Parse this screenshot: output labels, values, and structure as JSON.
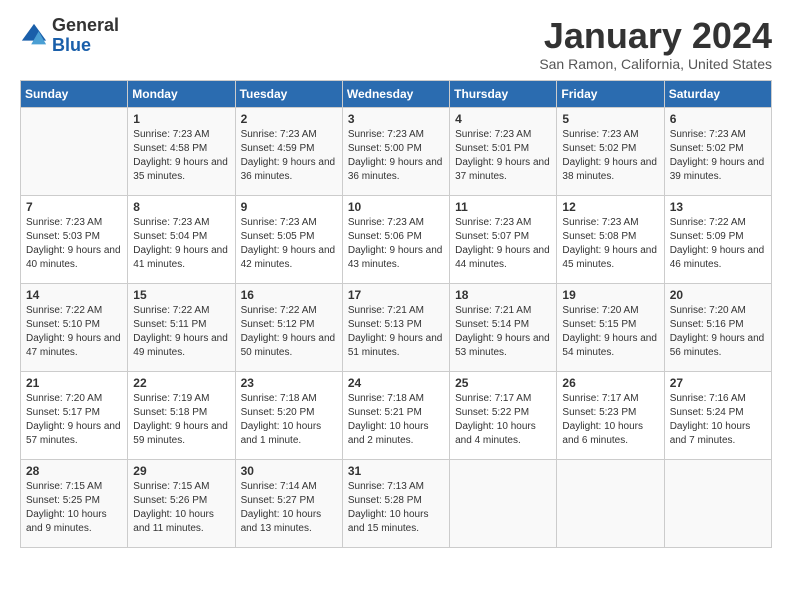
{
  "logo": {
    "general": "General",
    "blue": "Blue"
  },
  "header": {
    "title": "January 2024",
    "location": "San Ramon, California, United States"
  },
  "days_of_week": [
    "Sunday",
    "Monday",
    "Tuesday",
    "Wednesday",
    "Thursday",
    "Friday",
    "Saturday"
  ],
  "weeks": [
    [
      {
        "day": "",
        "sunrise": "",
        "sunset": "",
        "daylight": ""
      },
      {
        "day": "1",
        "sunrise": "Sunrise: 7:23 AM",
        "sunset": "Sunset: 4:58 PM",
        "daylight": "Daylight: 9 hours and 35 minutes."
      },
      {
        "day": "2",
        "sunrise": "Sunrise: 7:23 AM",
        "sunset": "Sunset: 4:59 PM",
        "daylight": "Daylight: 9 hours and 36 minutes."
      },
      {
        "day": "3",
        "sunrise": "Sunrise: 7:23 AM",
        "sunset": "Sunset: 5:00 PM",
        "daylight": "Daylight: 9 hours and 36 minutes."
      },
      {
        "day": "4",
        "sunrise": "Sunrise: 7:23 AM",
        "sunset": "Sunset: 5:01 PM",
        "daylight": "Daylight: 9 hours and 37 minutes."
      },
      {
        "day": "5",
        "sunrise": "Sunrise: 7:23 AM",
        "sunset": "Sunset: 5:02 PM",
        "daylight": "Daylight: 9 hours and 38 minutes."
      },
      {
        "day": "6",
        "sunrise": "Sunrise: 7:23 AM",
        "sunset": "Sunset: 5:02 PM",
        "daylight": "Daylight: 9 hours and 39 minutes."
      }
    ],
    [
      {
        "day": "7",
        "sunrise": "Sunrise: 7:23 AM",
        "sunset": "Sunset: 5:03 PM",
        "daylight": "Daylight: 9 hours and 40 minutes."
      },
      {
        "day": "8",
        "sunrise": "Sunrise: 7:23 AM",
        "sunset": "Sunset: 5:04 PM",
        "daylight": "Daylight: 9 hours and 41 minutes."
      },
      {
        "day": "9",
        "sunrise": "Sunrise: 7:23 AM",
        "sunset": "Sunset: 5:05 PM",
        "daylight": "Daylight: 9 hours and 42 minutes."
      },
      {
        "day": "10",
        "sunrise": "Sunrise: 7:23 AM",
        "sunset": "Sunset: 5:06 PM",
        "daylight": "Daylight: 9 hours and 43 minutes."
      },
      {
        "day": "11",
        "sunrise": "Sunrise: 7:23 AM",
        "sunset": "Sunset: 5:07 PM",
        "daylight": "Daylight: 9 hours and 44 minutes."
      },
      {
        "day": "12",
        "sunrise": "Sunrise: 7:23 AM",
        "sunset": "Sunset: 5:08 PM",
        "daylight": "Daylight: 9 hours and 45 minutes."
      },
      {
        "day": "13",
        "sunrise": "Sunrise: 7:22 AM",
        "sunset": "Sunset: 5:09 PM",
        "daylight": "Daylight: 9 hours and 46 minutes."
      }
    ],
    [
      {
        "day": "14",
        "sunrise": "Sunrise: 7:22 AM",
        "sunset": "Sunset: 5:10 PM",
        "daylight": "Daylight: 9 hours and 47 minutes."
      },
      {
        "day": "15",
        "sunrise": "Sunrise: 7:22 AM",
        "sunset": "Sunset: 5:11 PM",
        "daylight": "Daylight: 9 hours and 49 minutes."
      },
      {
        "day": "16",
        "sunrise": "Sunrise: 7:22 AM",
        "sunset": "Sunset: 5:12 PM",
        "daylight": "Daylight: 9 hours and 50 minutes."
      },
      {
        "day": "17",
        "sunrise": "Sunrise: 7:21 AM",
        "sunset": "Sunset: 5:13 PM",
        "daylight": "Daylight: 9 hours and 51 minutes."
      },
      {
        "day": "18",
        "sunrise": "Sunrise: 7:21 AM",
        "sunset": "Sunset: 5:14 PM",
        "daylight": "Daylight: 9 hours and 53 minutes."
      },
      {
        "day": "19",
        "sunrise": "Sunrise: 7:20 AM",
        "sunset": "Sunset: 5:15 PM",
        "daylight": "Daylight: 9 hours and 54 minutes."
      },
      {
        "day": "20",
        "sunrise": "Sunrise: 7:20 AM",
        "sunset": "Sunset: 5:16 PM",
        "daylight": "Daylight: 9 hours and 56 minutes."
      }
    ],
    [
      {
        "day": "21",
        "sunrise": "Sunrise: 7:20 AM",
        "sunset": "Sunset: 5:17 PM",
        "daylight": "Daylight: 9 hours and 57 minutes."
      },
      {
        "day": "22",
        "sunrise": "Sunrise: 7:19 AM",
        "sunset": "Sunset: 5:18 PM",
        "daylight": "Daylight: 9 hours and 59 minutes."
      },
      {
        "day": "23",
        "sunrise": "Sunrise: 7:18 AM",
        "sunset": "Sunset: 5:20 PM",
        "daylight": "Daylight: 10 hours and 1 minute."
      },
      {
        "day": "24",
        "sunrise": "Sunrise: 7:18 AM",
        "sunset": "Sunset: 5:21 PM",
        "daylight": "Daylight: 10 hours and 2 minutes."
      },
      {
        "day": "25",
        "sunrise": "Sunrise: 7:17 AM",
        "sunset": "Sunset: 5:22 PM",
        "daylight": "Daylight: 10 hours and 4 minutes."
      },
      {
        "day": "26",
        "sunrise": "Sunrise: 7:17 AM",
        "sunset": "Sunset: 5:23 PM",
        "daylight": "Daylight: 10 hours and 6 minutes."
      },
      {
        "day": "27",
        "sunrise": "Sunrise: 7:16 AM",
        "sunset": "Sunset: 5:24 PM",
        "daylight": "Daylight: 10 hours and 7 minutes."
      }
    ],
    [
      {
        "day": "28",
        "sunrise": "Sunrise: 7:15 AM",
        "sunset": "Sunset: 5:25 PM",
        "daylight": "Daylight: 10 hours and 9 minutes."
      },
      {
        "day": "29",
        "sunrise": "Sunrise: 7:15 AM",
        "sunset": "Sunset: 5:26 PM",
        "daylight": "Daylight: 10 hours and 11 minutes."
      },
      {
        "day": "30",
        "sunrise": "Sunrise: 7:14 AM",
        "sunset": "Sunset: 5:27 PM",
        "daylight": "Daylight: 10 hours and 13 minutes."
      },
      {
        "day": "31",
        "sunrise": "Sunrise: 7:13 AM",
        "sunset": "Sunset: 5:28 PM",
        "daylight": "Daylight: 10 hours and 15 minutes."
      },
      {
        "day": "",
        "sunrise": "",
        "sunset": "",
        "daylight": ""
      },
      {
        "day": "",
        "sunrise": "",
        "sunset": "",
        "daylight": ""
      },
      {
        "day": "",
        "sunrise": "",
        "sunset": "",
        "daylight": ""
      }
    ]
  ]
}
